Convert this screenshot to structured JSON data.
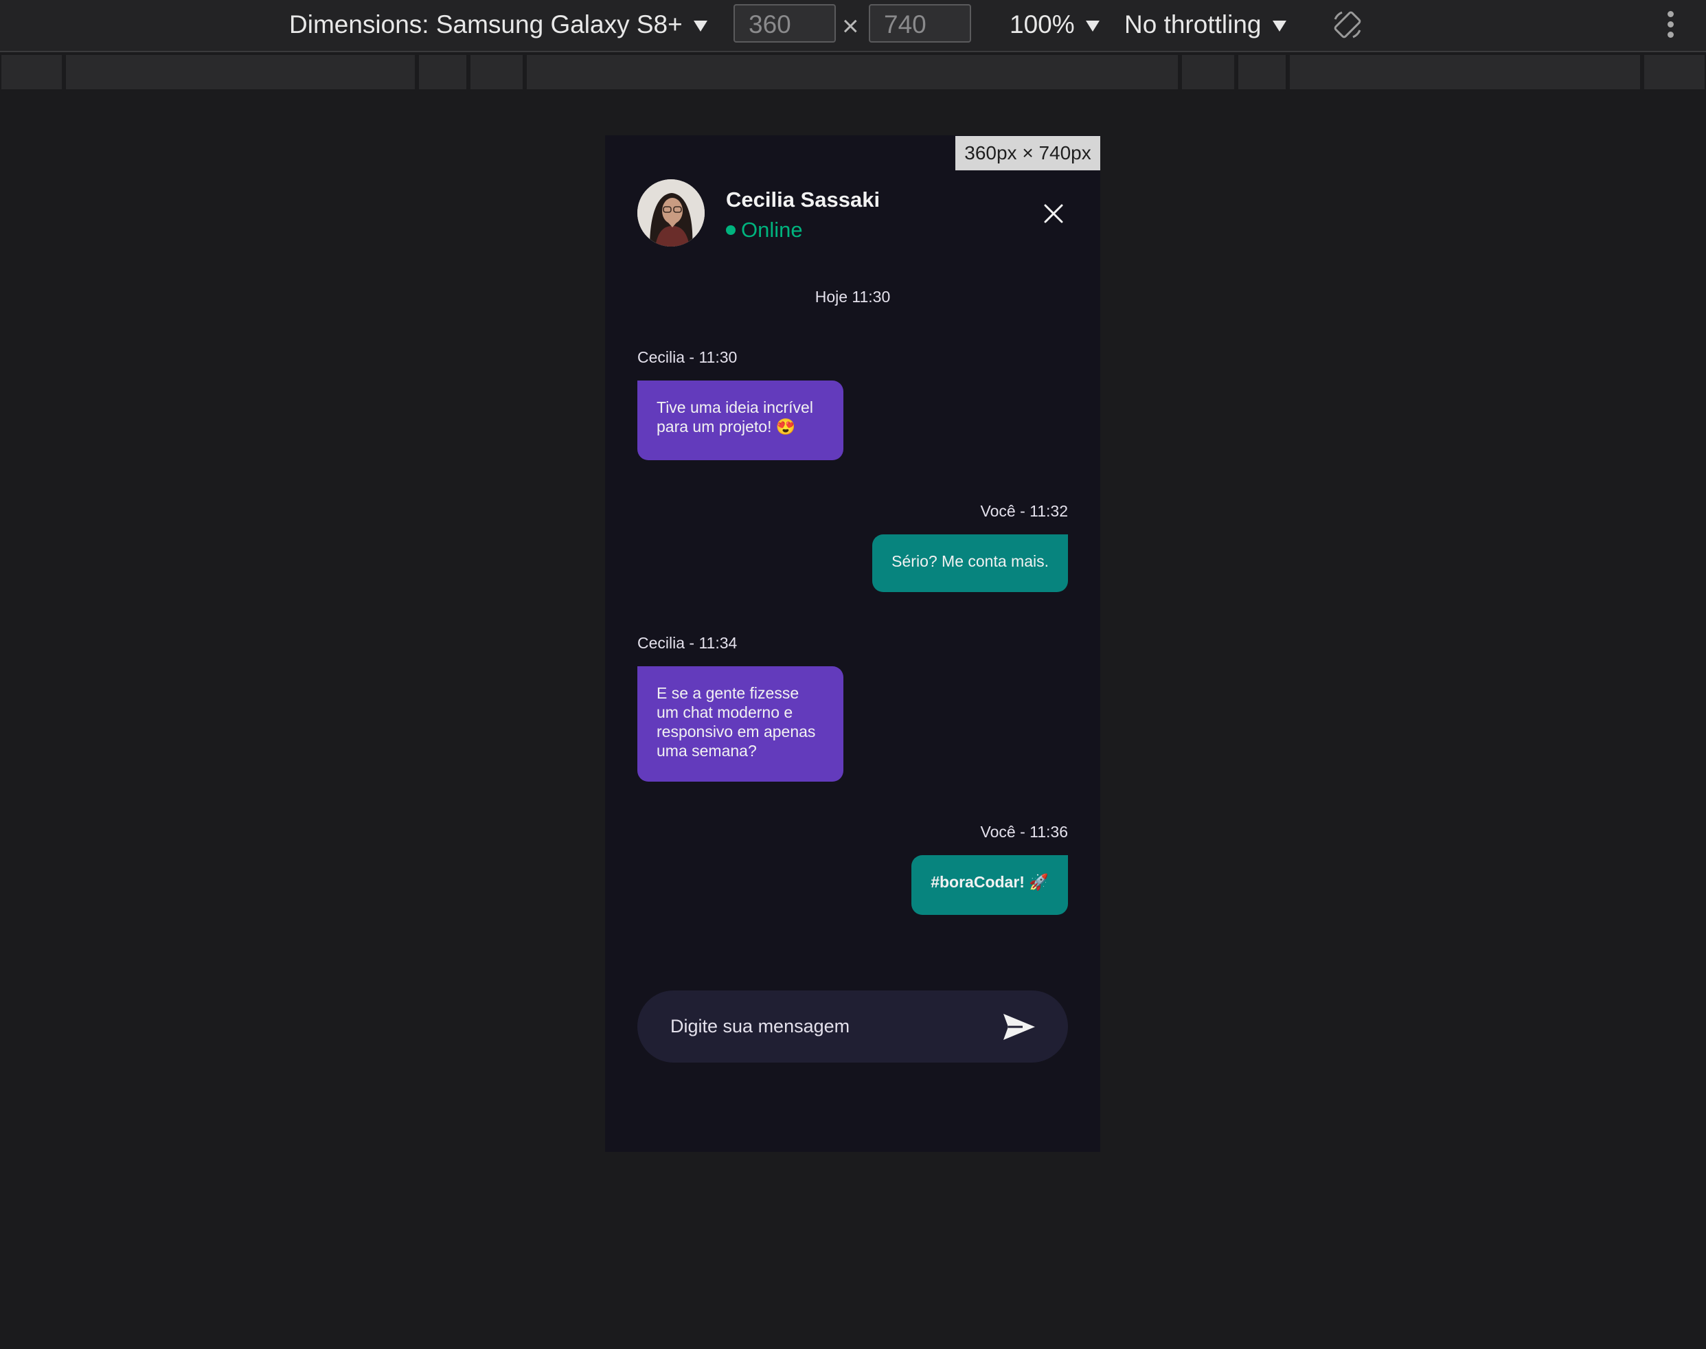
{
  "toolbar": {
    "dimensions_label": "Dimensions: Samsung Galaxy S8+",
    "width_value": "360",
    "height_value": "740",
    "times_glyph": "×",
    "zoom_label": "100%",
    "throttle_label": "No throttling",
    "rotate_icon": "rotate-icon",
    "more_icon": "kebab-menu-icon"
  },
  "device": {
    "size_badge": "360px × 740px",
    "background_color": "#13121c"
  },
  "chat": {
    "contact_name": "Cecilia Sassaki",
    "status": "Online",
    "status_color": "#00b37e",
    "day_stamp": "Hoje 11:30",
    "messages": [
      {
        "author_time": "Cecilia - 11:30",
        "text": "Tive uma ideia incrível para um projeto! 😍",
        "side": "in"
      },
      {
        "author_time": "Você - 11:32",
        "text": "Sério? Me conta mais.",
        "side": "out"
      },
      {
        "author_time": "Cecilia - 11:34",
        "text": "E se a gente fizesse um chat moderno e responsivo em apenas uma semana?",
        "side": "in"
      },
      {
        "author_time": "Você - 11:36",
        "text": "#boraCodar! 🚀",
        "side": "out"
      }
    ],
    "incoming_color": "#633bbc",
    "outgoing_color": "#07847e",
    "composer_placeholder": "Digite sua mensagem"
  }
}
